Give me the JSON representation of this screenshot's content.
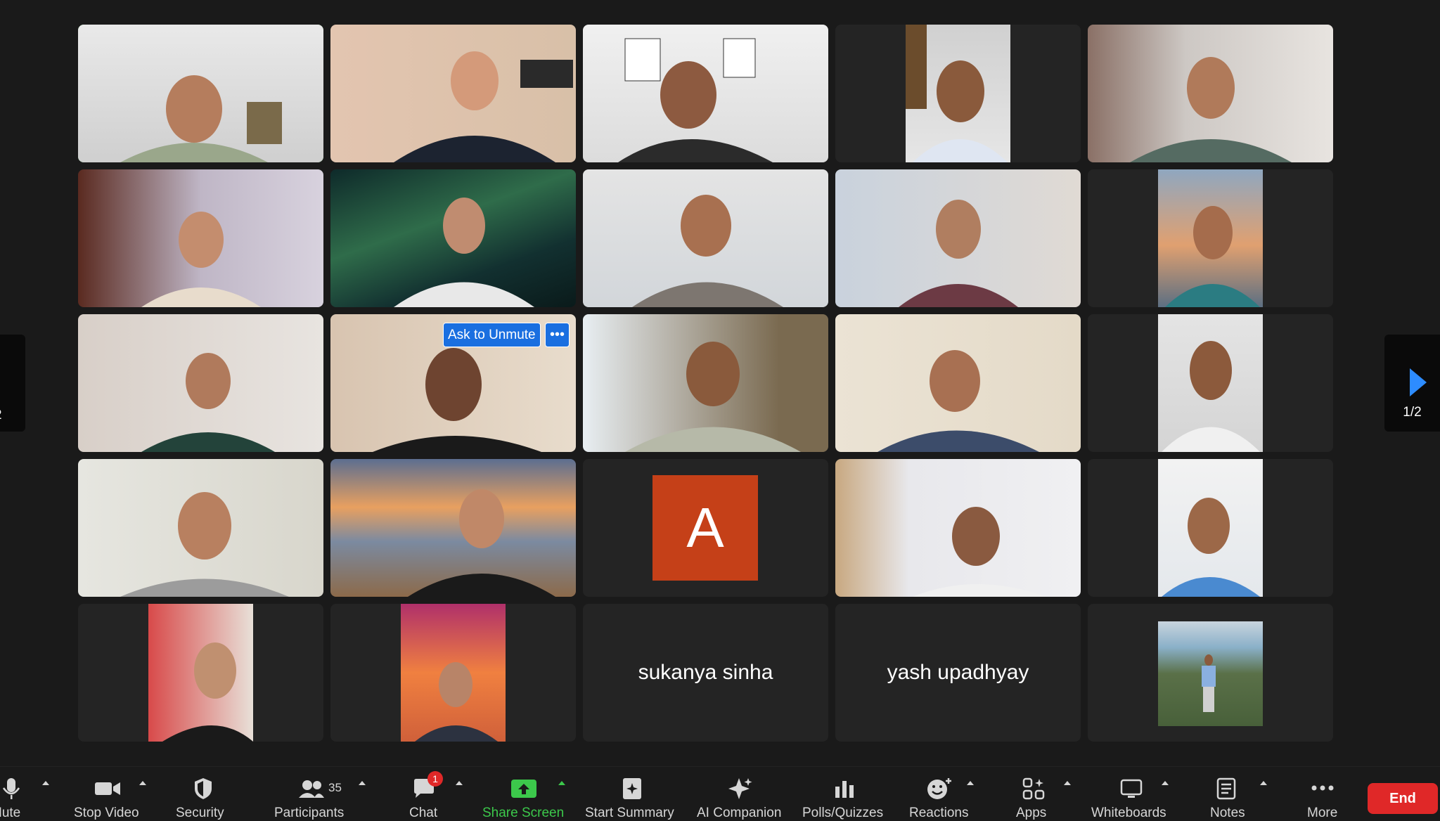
{
  "meeting": {
    "ask_to_unmute_label": "Ask to Unmute",
    "ask_more_label": "•••",
    "page_indicator": "1/2",
    "page_indicator_left": "2",
    "avatar_letter": "A",
    "name_tiles": [
      "sukanya sinha",
      "yash upadhyay"
    ]
  },
  "toolbar": {
    "mute_label": "Mute",
    "stop_video_label": "Stop Video",
    "security_label": "Security",
    "participants_label": "Participants",
    "participants_count": "35",
    "chat_label": "Chat",
    "chat_badge": "1",
    "share_screen_label": "Share Screen",
    "start_summary_label": "Start Summary",
    "ai_companion_label": "AI Companion",
    "polls_label": "Polls/Quizzes",
    "reactions_label": "Reactions",
    "apps_label": "Apps",
    "whiteboards_label": "Whiteboards",
    "notes_label": "Notes",
    "more_label": "More",
    "end_label": "End"
  },
  "colors": {
    "active_speaker": "#3cc84b",
    "share_screen": "#3cc84b",
    "end_button": "#e02828",
    "accent": "#2d8cff",
    "avatar_bg": "#c54018"
  }
}
